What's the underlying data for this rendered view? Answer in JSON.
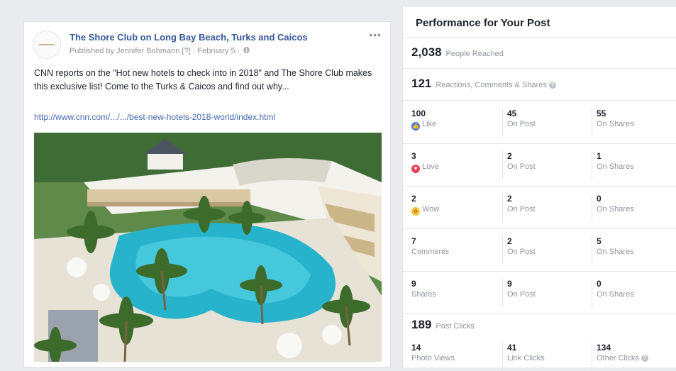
{
  "post": {
    "page_name": "The Shore Club on Long Bay Beach, Turks and Caicos",
    "published": "Published by Jennifer Bohmann [?] · February 5 ·",
    "more_icon": "more-horizontal-icon",
    "text": "CNN reports on the \"Hot new hotels to check into in 2018\" and The Shore Club makes this exclusive list! Come to the Turks & Caicos and find out why...",
    "link": "http://www.cnn.com/.../.../best-new-hotels-2018-world/index.html",
    "image_subject": "aerial-resort-pool-photo"
  },
  "performance": {
    "title": "Performance for Your Post",
    "people_reached": {
      "value": "2,038",
      "label": "People Reached"
    },
    "engagement": {
      "value": "121",
      "label": "Reactions, Comments & Shares"
    },
    "rows": [
      {
        "icon": "like-icon",
        "total": "100",
        "label": "Like",
        "on_post": "45",
        "on_post_label": "On Post",
        "on_shares": "55",
        "on_shares_label": "On Shares"
      },
      {
        "icon": "love-icon",
        "total": "3",
        "label": "Love",
        "on_post": "2",
        "on_post_label": "On Post",
        "on_shares": "1",
        "on_shares_label": "On Shares"
      },
      {
        "icon": "wow-icon",
        "total": "2",
        "label": "Wow",
        "on_post": "2",
        "on_post_label": "On Post",
        "on_shares": "0",
        "on_shares_label": "On Shares"
      },
      {
        "icon": "",
        "total": "7",
        "label": "Comments",
        "on_post": "2",
        "on_post_label": "On Post",
        "on_shares": "5",
        "on_shares_label": "On Shares"
      },
      {
        "icon": "",
        "total": "9",
        "label": "Shares",
        "on_post": "9",
        "on_post_label": "On Post",
        "on_shares": "0",
        "on_shares_label": "On Shares"
      }
    ],
    "post_clicks": {
      "value": "189",
      "label": "Post Clicks"
    },
    "clicks": [
      {
        "value": "14",
        "label": "Photo Views"
      },
      {
        "value": "41",
        "label": "Link Clicks"
      },
      {
        "value": "134",
        "label": "Other Clicks"
      }
    ]
  },
  "colors": {
    "link_blue": "#365899",
    "like_blue": "#4a7ad8",
    "love_red": "#e8435a",
    "wow_yellow": "#f5c33b",
    "muted_gray": "#90949c"
  }
}
